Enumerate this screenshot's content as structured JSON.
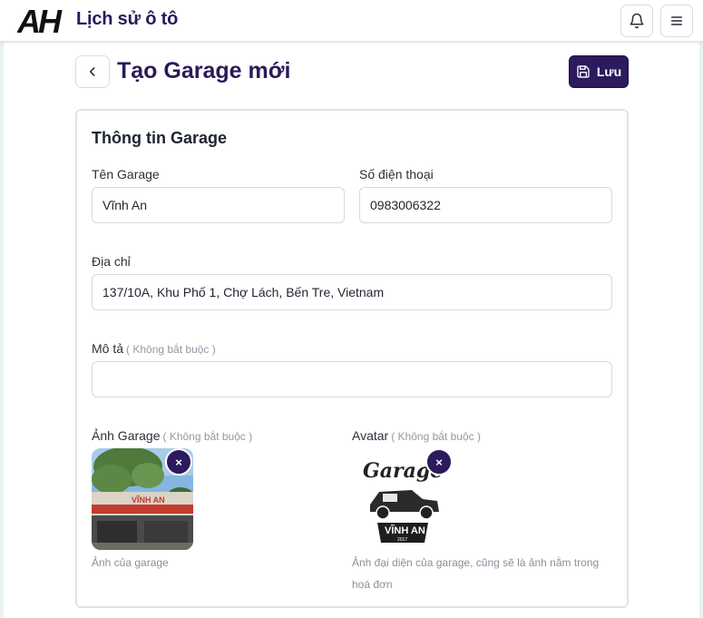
{
  "header": {
    "brand": "Lịch sử ô tô",
    "logo_text": "AH",
    "icons": [
      "bell-icon",
      "menu-icon"
    ]
  },
  "page": {
    "title": "Tạo Garage mới",
    "save_label": "Lưu",
    "icons": [
      "chevron-left-icon",
      "save-icon"
    ]
  },
  "form": {
    "section_title": "Thông tin Garage",
    "name": {
      "label": "Tên Garage",
      "value": "Vĩnh An"
    },
    "phone": {
      "label": "Số điện thoại",
      "value": "0983006322"
    },
    "address": {
      "label": "Địa chỉ",
      "value": "137/10A, Khu Phố 1, Chợ Lách, Bến Tre, Vietnam"
    },
    "description": {
      "label": "Mô tả",
      "optional": "( Không bắt buộc )",
      "value": ""
    },
    "garage_photo": {
      "label": "Ảnh Garage",
      "optional": "( Không bắt buộc )",
      "hint": "Ảnh của garage",
      "sign_text": "VĨNH AN"
    },
    "avatar": {
      "label": "Avatar",
      "optional": "( Không bắt buộc )",
      "hint": "Ảnh đại diện của garage, cũng sẽ là ảnh nằm trong hoá đơn",
      "logo_script": "Garage",
      "logo_name": "VĨNH AN",
      "logo_year": "2017"
    },
    "remove_symbol": "×"
  },
  "colors": {
    "primary": "#2c1a5e",
    "title": "#2b1a5a",
    "border": "#d7d9de"
  }
}
